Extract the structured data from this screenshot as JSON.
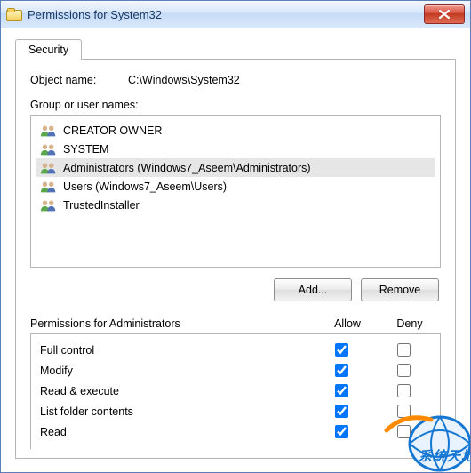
{
  "title": "Permissions for System32",
  "tabs": {
    "security": "Security"
  },
  "object_label": "Object name:",
  "object_value": "C:\\Windows\\System32",
  "group_label": "Group or user names:",
  "users": [
    {
      "name": "CREATOR OWNER"
    },
    {
      "name": "SYSTEM"
    },
    {
      "name": "Administrators (Windows7_Aseem\\Administrators)"
    },
    {
      "name": "Users (Windows7_Aseem\\Users)"
    },
    {
      "name": "TrustedInstaller"
    }
  ],
  "buttons": {
    "add": "Add...",
    "remove": "Remove"
  },
  "perm_label": "Permissions for Administrators",
  "col_allow": "Allow",
  "col_deny": "Deny",
  "perms": [
    {
      "name": "Full control",
      "allow": true,
      "deny": false
    },
    {
      "name": "Modify",
      "allow": true,
      "deny": false
    },
    {
      "name": "Read & execute",
      "allow": true,
      "deny": false
    },
    {
      "name": "List folder contents",
      "allow": true,
      "deny": false
    },
    {
      "name": "Read",
      "allow": true,
      "deny": false
    }
  ],
  "watermark": "系统天地"
}
